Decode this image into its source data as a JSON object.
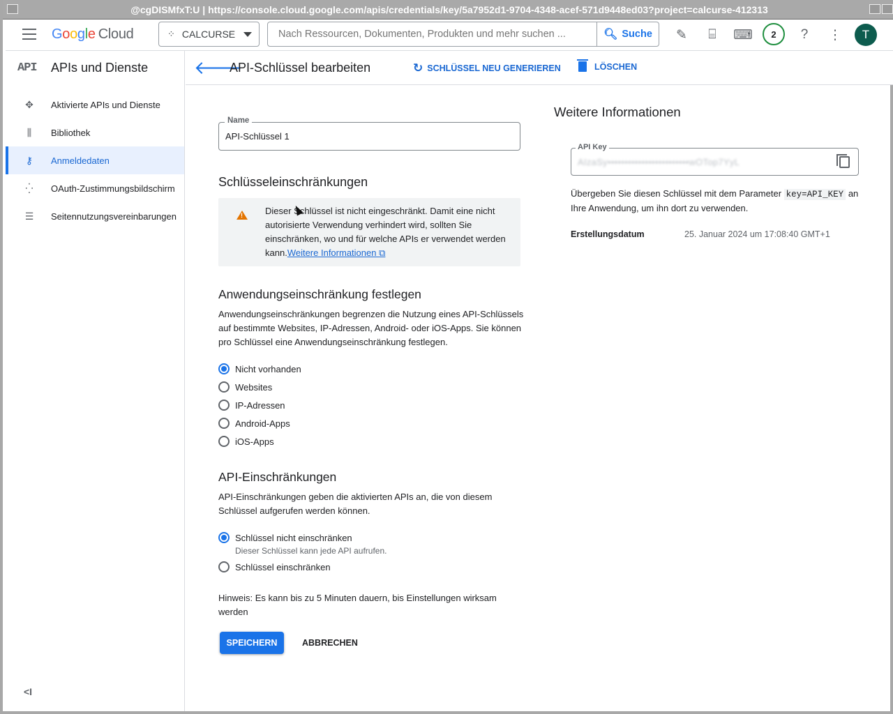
{
  "window": {
    "title": "@cgDISMfxT:U | https://console.cloud.google.com/apis/credentials/key/5a7952d1-9704-4348-acef-571d9448ed03?project=calcurse-412313"
  },
  "appbar": {
    "logo_google": [
      "G",
      "o",
      "o",
      "g",
      "l",
      "e"
    ],
    "logo_cloud": "Cloud",
    "project_name": "CALCURSE",
    "search_placeholder": "Nach Ressourcen, Dokumenten, Produkten und mehr suchen ...",
    "search_button": "Suche",
    "notifications_count": "2",
    "avatar_initial": "T"
  },
  "sidebar": {
    "product_icon": "API",
    "title": "APIs und Dienste",
    "items": [
      {
        "label": "Aktivierte APIs und Dienste",
        "icon": "apis-icon",
        "active": false
      },
      {
        "label": "Bibliothek",
        "icon": "library-icon",
        "active": false
      },
      {
        "label": "Anmeldedaten",
        "icon": "key-icon",
        "active": true
      },
      {
        "label": "OAuth-Zustimmungsbildschirm",
        "icon": "oauth-icon",
        "active": false
      },
      {
        "label": "Seitennutzungsvereinbarungen",
        "icon": "settings-list-icon",
        "active": false
      }
    ],
    "collapse_label": "<I"
  },
  "page_header": {
    "title": "API-Schlüssel bearbeiten",
    "regenerate_label": "SCHLÜSSEL NEU GENERIEREN",
    "delete_label": "LÖSCHEN"
  },
  "form": {
    "name_label": "Name",
    "name_value": "API-Schlüssel 1",
    "key_restrictions_heading": "Schlüsseleinschränkungen",
    "warning_text": "Dieser Schlüssel ist nicht eingeschränkt. Damit eine nicht autorisierte Verwendung verhindert wird, sollten Sie einschränken, wo und für welche APIs er verwendet werden kann.",
    "warning_link": "Weitere Informationen",
    "app_restriction_heading": "Anwendungseinschränkung festlegen",
    "app_restriction_text": "Anwendungseinschränkungen begrenzen die Nutzung eines API-Schlüssels auf bestimmte Websites, IP-Adressen, Android- oder iOS-Apps. Sie können pro Schlüssel eine Anwendungseinschränkung festlegen.",
    "app_options": [
      {
        "label": "Nicht vorhanden",
        "selected": true
      },
      {
        "label": "Websites",
        "selected": false
      },
      {
        "label": "IP-Adressen",
        "selected": false
      },
      {
        "label": "Android-Apps",
        "selected": false
      },
      {
        "label": "iOS-Apps",
        "selected": false
      }
    ],
    "api_restriction_heading": "API-Einschränkungen",
    "api_restriction_text": "API-Einschränkungen geben die aktivierten APIs an, die von diesem Schlüssel aufgerufen werden können.",
    "api_options": [
      {
        "label": "Schlüssel nicht einschränken",
        "sublabel": "Dieser Schlüssel kann jede API aufrufen.",
        "selected": true
      },
      {
        "label": "Schlüssel einschränken",
        "sublabel": "",
        "selected": false
      }
    ],
    "hint_text": "Hinweis: Es kann bis zu 5 Minuten dauern, bis Einstellungen wirksam werden",
    "save_label": "SPEICHERN",
    "cancel_label": "ABBRECHEN"
  },
  "info_panel": {
    "title": "Weitere Informationen",
    "api_key_label": "API Key",
    "api_key_value": "AIzaSy••••••••••••••••••••••••wOTop7YyL",
    "usage_text_before": "Übergeben Sie diesen Schlüssel mit dem Parameter",
    "usage_code": "key=API_KEY",
    "usage_text_after": "an Ihre Anwendung, um ihn dort zu verwenden.",
    "created_label": "Erstellungsdatum",
    "created_value": "25. Januar 2024 um 17:08:40 GMT+1"
  },
  "colors": {
    "accent": "#1a73e8",
    "warning": "#e37400",
    "active_bg": "#e8f0fe"
  }
}
